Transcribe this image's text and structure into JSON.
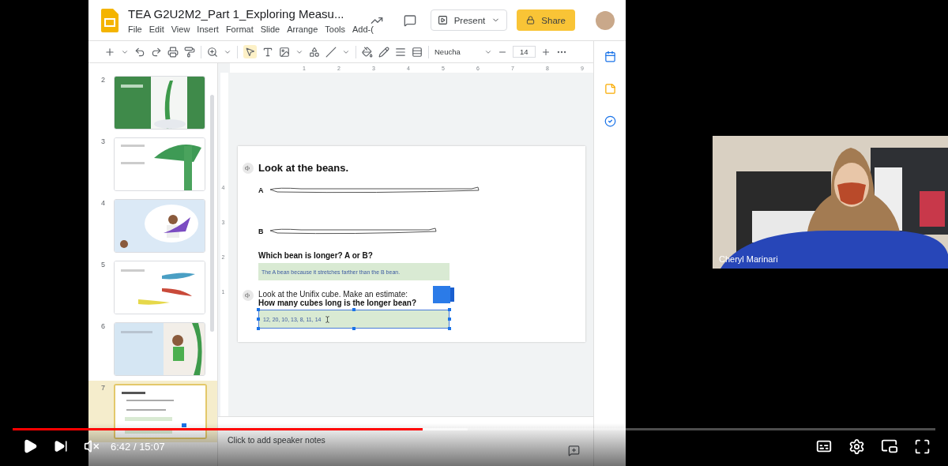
{
  "app": {
    "title": "TEA G2U2M2_Part 1_Exploring Measu...",
    "menu": [
      "File",
      "Edit",
      "View",
      "Insert",
      "Format",
      "Slide",
      "Arrange",
      "Tools",
      "Add-("
    ],
    "present": "Present",
    "share": "Share",
    "font": "Neucha",
    "font_size": "14"
  },
  "filmstrip": [
    {
      "number": "2",
      "selected": false
    },
    {
      "number": "3",
      "selected": false
    },
    {
      "number": "4",
      "selected": false
    },
    {
      "number": "5",
      "selected": false
    },
    {
      "number": "6",
      "selected": false
    },
    {
      "number": "7",
      "selected": true
    }
  ],
  "ruler": {
    "horizontal": [
      "1",
      "2",
      "3",
      "4",
      "5",
      "6",
      "7",
      "8",
      "9"
    ],
    "vertical": [
      "4",
      "3",
      "2",
      "1"
    ]
  },
  "slide": {
    "heading": "Look at the beans.",
    "beans": [
      {
        "label": "A"
      },
      {
        "label": "B"
      }
    ],
    "question": "Which bean is longer? A or B?",
    "answer": "The A bean because it stretches farther than the B bean.",
    "prompt": "Look at the Unifix cube. Make an estimate:",
    "prompt_bold": "How many cubes long is the longer bean?",
    "estimate": {
      "value": "12, 20, 10, 13, 8, 11, 14",
      "selected": true
    }
  },
  "notes": {
    "placeholder": "Click to add speaker notes"
  },
  "webcam": {
    "name": "Cheryl Marinari"
  },
  "player": {
    "time": "6:42 / 15:07",
    "muted": true,
    "progress": {
      "level": 0.444
    },
    "buffer": {
      "level": 0.493
    }
  }
}
